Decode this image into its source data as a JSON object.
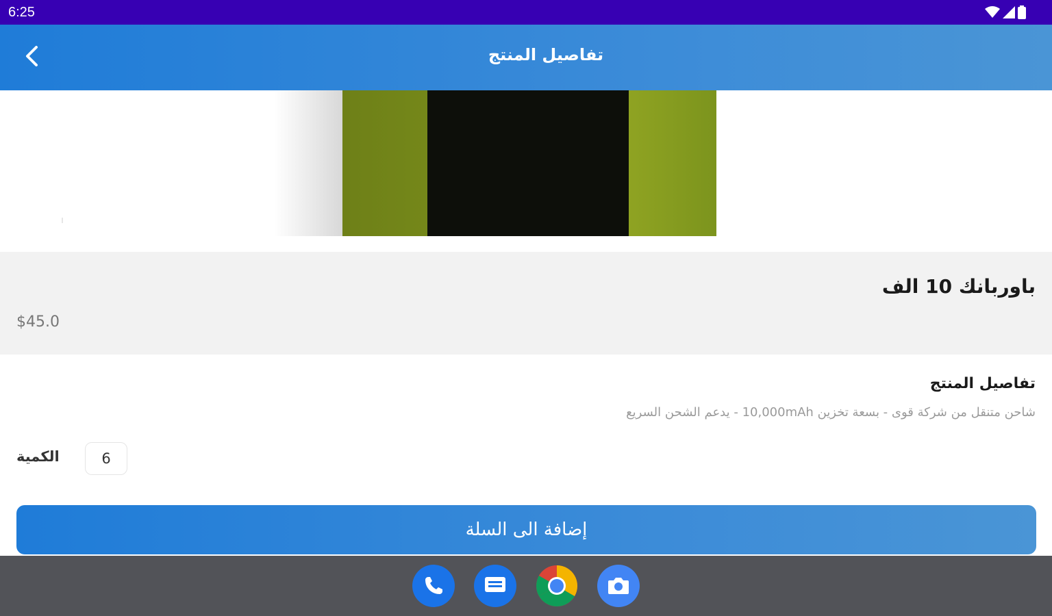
{
  "status_bar": {
    "time": "6:25",
    "icons": [
      "wifi-icon",
      "signal-icon",
      "battery-icon"
    ]
  },
  "app_bar": {
    "title": "تفاصيل المنتج",
    "back_icon": "chevron-left-icon"
  },
  "product": {
    "name": "باوربانك 10 الف",
    "price": "$45.0",
    "details_heading": "تفاصيل المنتج",
    "details_text": "شاحن متنقل من شركة قوى - بسعة تخزين 10,000mAh - يدعم الشحن السريع",
    "quantity_label": "الكمية",
    "quantity_value": "6",
    "add_to_cart_label": "إضافة الى السلة"
  },
  "dock": {
    "apps": [
      "phone-icon",
      "messages-icon",
      "chrome-icon",
      "camera-icon"
    ]
  },
  "colors": {
    "status_bar": "#3700b3",
    "accent": "#1f7cd8",
    "info_background": "#f2f2f2",
    "nav_bar": "#525358"
  }
}
